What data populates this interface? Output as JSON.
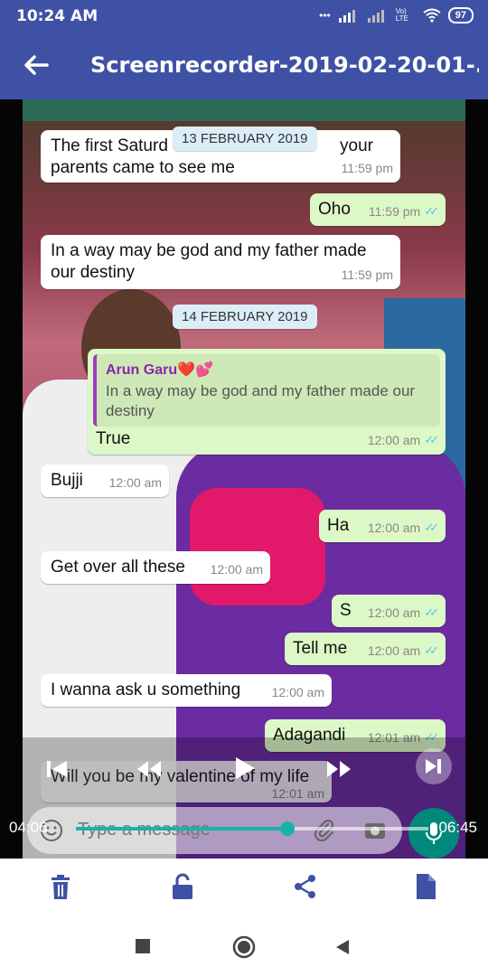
{
  "status": {
    "time": "10:24 AM",
    "battery": "97",
    "network": "Vo) LTE"
  },
  "appbar": {
    "title": "Screenrecorder-2019-02-20-01-..."
  },
  "chat": {
    "date1": "13 FEBRUARY 2019",
    "date2": "14 FEBRUARY 2019",
    "m1_line1_a": "The first Saturd",
    "m1_line1_b": "your",
    "m1_line2": "parents came to see me",
    "m1_time": "11:59 pm",
    "m2_text": "Oho",
    "m2_time": "11:59 pm",
    "m3_line1": "In a way may be god and my father made",
    "m3_line2": "our destiny",
    "m3_time": "11:59 pm",
    "m4_quote_author": "Arun Garu❤️💕",
    "m4_quote_text": "In a way may be god and my father made our destiny",
    "m4_text": "True",
    "m4_time": "12:00 am",
    "m5_text": "Bujji",
    "m5_time": "12:00 am",
    "m6_text": "Ha",
    "m6_time": "12:00 am",
    "m7_text": "Get over all these",
    "m7_time": "12:00 am",
    "m8_text": "S",
    "m8_time": "12:00 am",
    "m9_text": "Tell me",
    "m9_time": "12:00 am",
    "m10_text": "I wanna ask u something",
    "m10_time": "12:00 am",
    "m11_text": "Adagandi",
    "m11_time": "12:01 am",
    "m12_text": "Will you be my valentine of my life",
    "m12_time": "12:01 am",
    "composer_placeholder": "Type a message"
  },
  "player": {
    "current_time": "04:06",
    "total_time": "06:45",
    "progress_fraction": 0.6
  },
  "colors": {
    "appbar": "#3f51a5",
    "bubble_out": "#dcf8c6",
    "bubble_in": "#ffffff",
    "accent": "#18b3a8",
    "tick": "#4fc3f7"
  },
  "icons": [
    "back-arrow-icon",
    "delete-icon",
    "unlock-icon",
    "share-icon",
    "file-icon",
    "stop-square-icon",
    "home-circle-icon",
    "back-triangle-icon",
    "skip-previous-icon",
    "rewind-icon",
    "play-icon",
    "fast-forward-icon",
    "skip-next-icon",
    "emoji-icon",
    "attach-icon",
    "camera-icon",
    "mic-icon"
  ]
}
